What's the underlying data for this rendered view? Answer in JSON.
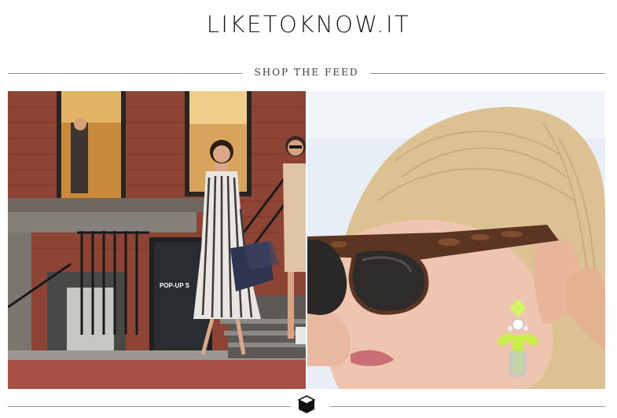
{
  "header": {
    "logo_text": "LIKETOKNOW.IT"
  },
  "section": {
    "title": "SHOP THE FEED"
  },
  "feed": {
    "items": [
      {
        "image": "street-shopping-photo",
        "sign_text": "POP-UP S"
      },
      {
        "image": "sunglasses-earring-closeup-photo"
      }
    ]
  },
  "footer": {
    "icon": "box-icon"
  },
  "colors": {
    "text": "#1a1a1a",
    "rule": "#8a8a8a",
    "brick": "#8a3b2c",
    "neon_earring": "#c9f04a"
  }
}
